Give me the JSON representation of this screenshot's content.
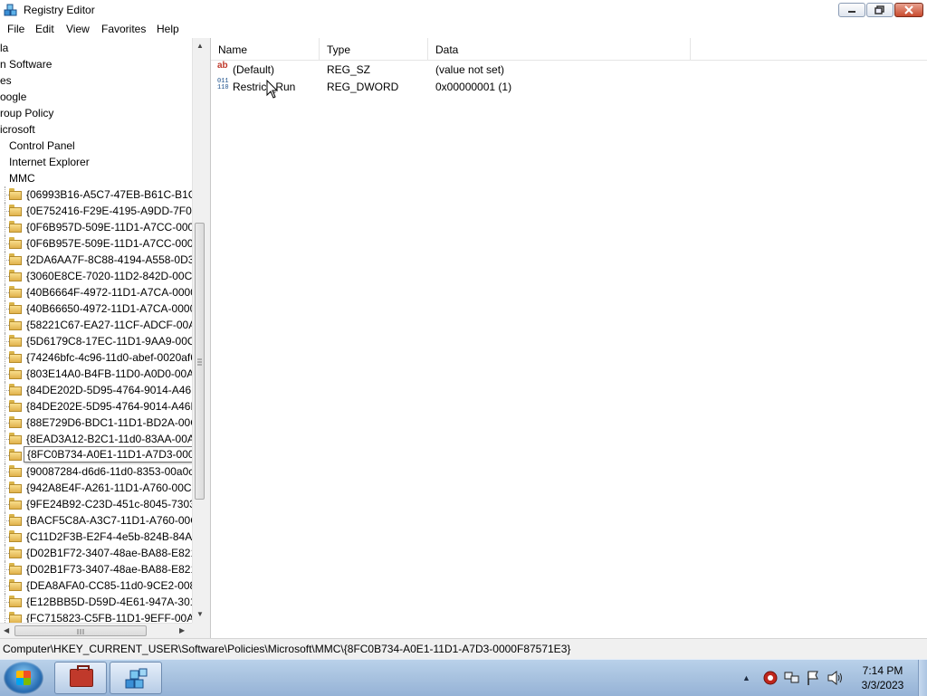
{
  "window": {
    "title": "Registry Editor"
  },
  "menu": [
    "File",
    "Edit",
    "View",
    "Favorites",
    "Help"
  ],
  "tree": {
    "top_items": [
      "la",
      "n Software",
      "es",
      "oogle",
      "roup Policy",
      "icrosoft"
    ],
    "sub_items": [
      "Control Panel",
      "Internet Explorer",
      "MMC"
    ],
    "mmc_keys": [
      "{06993B16-A5C7-47EB-B61C-B1CB",
      "{0E752416-F29E-4195-A9DD-7F0D4",
      "{0F6B957D-509E-11D1-A7CC-0000",
      "{0F6B957E-509E-11D1-A7CC-0000F",
      "{2DA6AA7F-8C88-4194-A558-0D36",
      "{3060E8CE-7020-11D2-842D-00C04",
      "{40B6664F-4972-11D1-A7CA-0000F",
      "{40B66650-4972-11D1-A7CA-0000F",
      "{58221C67-EA27-11CF-ADCF-00AA",
      "{5D6179C8-17EC-11D1-9AA9-00C0",
      "{74246bfc-4c96-11d0-abef-0020af6",
      "{803E14A0-B4FB-11D0-A0D0-00A0",
      "{84DE202D-5D95-4764-9014-A46F9",
      "{84DE202E-5D95-4764-9014-A46F9",
      "{88E729D6-BDC1-11D1-BD2A-00C0",
      "{8EAD3A12-B2C1-11d0-83AA-00A0",
      "",
      "{90087284-d6d6-11d0-8353-00a0c9",
      "{942A8E4F-A261-11D1-A760-00C04",
      "{9FE24B92-C23D-451c-8045-73038",
      "{BACF5C8A-A3C7-11D1-A760-00C",
      "{C11D2F3B-E2F4-4e5b-824B-84A87",
      "{D02B1F72-3407-48ae-BA88-E8213",
      "{D02B1F73-3407-48ae-BA88-E8213",
      "{DEA8AFA0-CC85-11d0-9CE2-0080",
      "{E12BBB5D-D59D-4E61-947A-301D",
      "{FC715823-C5FB-11D1-9EFF-00A0C"
    ],
    "tooltip": "{8FC0B734-A0E1-11D1-A7D3-0000F87571E3}"
  },
  "list": {
    "columns": [
      "Name",
      "Type",
      "Data"
    ],
    "rows": [
      {
        "name": "(Default)",
        "type": "REG_SZ",
        "data": "(value not set)",
        "icon": "string-value-icon"
      },
      {
        "name": "Restrict_Run",
        "type": "REG_DWORD",
        "data": "0x00000001 (1)",
        "icon": "dword-value-icon"
      }
    ]
  },
  "status": "Computer\\HKEY_CURRENT_USER\\Software\\Policies\\Microsoft\\MMC\\{8FC0B734-A0E1-11D1-A7D3-0000F87571E3}",
  "taskbar": {
    "time": "7:14 PM",
    "date": "3/3/2023"
  }
}
